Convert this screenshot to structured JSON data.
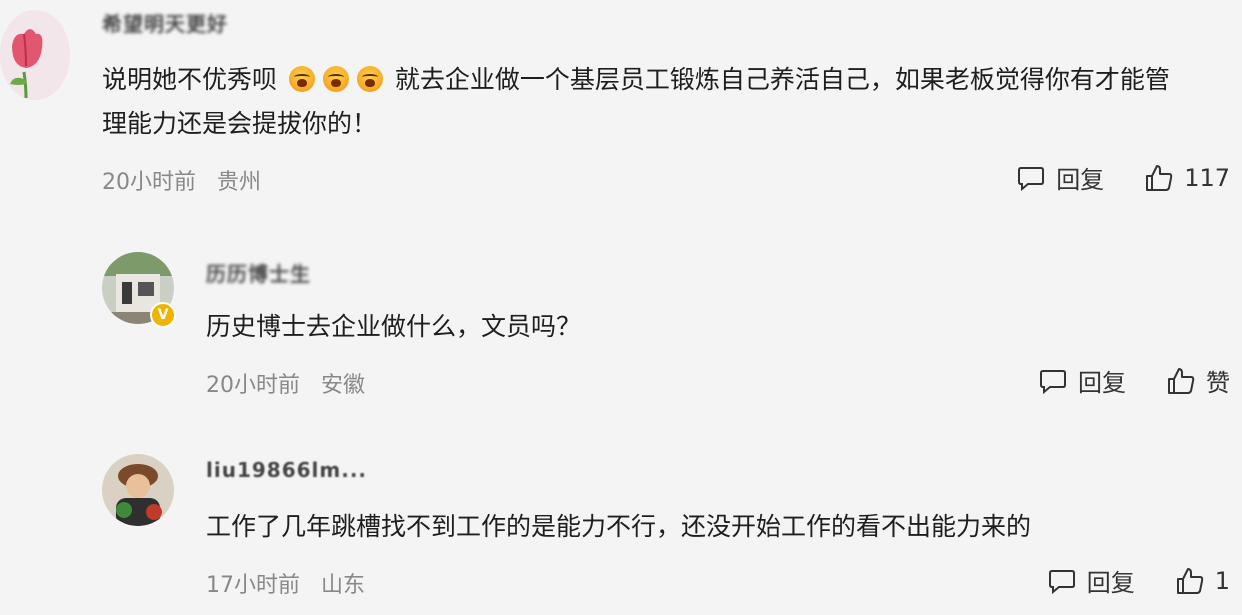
{
  "comments": [
    {
      "username": "希望明天更好",
      "content_before": "说明她不优秀呗",
      "content_after": "就去企业做一个基层员工锻炼自己养活自己，如果老板觉得你有才能管",
      "content_line2": "理能力还是会提拔你的！",
      "time": "20小时前",
      "location": "贵州",
      "reply_label": "回复",
      "like_label": "117"
    },
    {
      "username": "历历博士生",
      "content": "历史博士去企业做什么，文员吗？",
      "time": "20小时前",
      "location": "安徽",
      "reply_label": "回复",
      "like_label": "赞"
    },
    {
      "username": "liu19866lm...",
      "content": "工作了几年跳槽找不到工作的是能力不行，还没开始工作的看不出能力来的",
      "time": "17小时前",
      "location": "山东",
      "reply_label": "回复",
      "like_label": "1"
    }
  ],
  "icons": {
    "reply": "comment-bubble-icon",
    "like": "thumbs-up-icon",
    "emoji": "crying-face-emoji",
    "verified": "verified-badge-icon"
  },
  "colors": {
    "background": "#f4f4f4",
    "meta_text": "#888888",
    "badge": "#f0b400"
  }
}
